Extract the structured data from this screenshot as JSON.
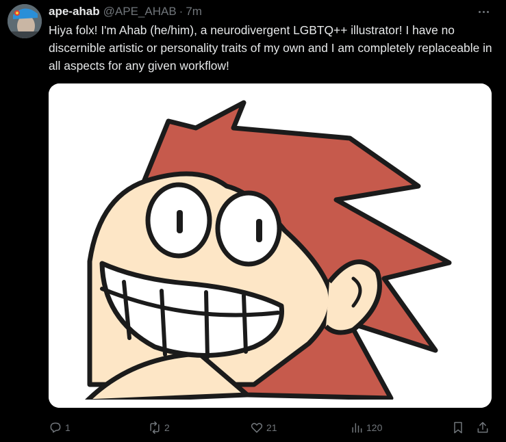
{
  "tweet": {
    "author_name": "ape-ahab",
    "handle": "@APE_AHAB",
    "separator": "·",
    "time": "7m",
    "text": "Hiya folx! I'm Ahab (he/him), a neurodivergent LGBTQ++ illustrator! I have no discernible artistic or personality traits of my own and I am completely replaceable in all aspects for any given workflow!"
  },
  "actions": {
    "replies": "1",
    "reposts": "2",
    "likes": "21",
    "views": "120"
  },
  "icons": {
    "reply": "reply-icon",
    "repost": "repost-icon",
    "like": "heart-icon",
    "views": "views-icon",
    "bookmark": "bookmark-icon",
    "share": "share-icon",
    "more": "more-icon"
  },
  "colors": {
    "background": "#000000",
    "text": "#e7e9ea",
    "muted": "#71767b",
    "hair": "#c65a4c",
    "skin": "#fde6c6"
  }
}
